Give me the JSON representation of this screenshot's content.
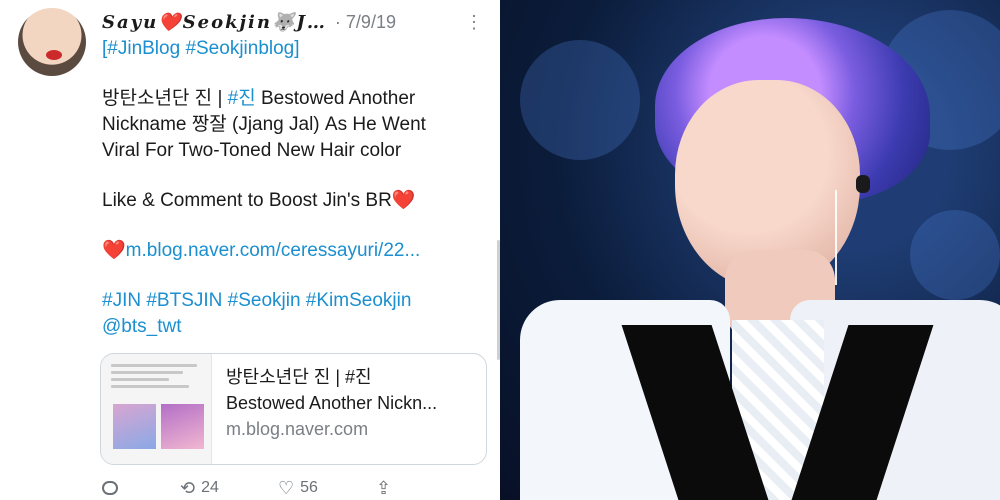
{
  "tweet": {
    "author_display_name": "𝑺𝒂𝒚𝒖❤️𝑺𝒆𝒐𝒌𝒋𝒊𝒏🐺𝑱…",
    "date": "· 7/9/19",
    "lines": {
      "tags_line": "[#JinBlog #Seokjinblog]",
      "headline_prefix": "방탄소년단 진 | ",
      "headline_hashtag": "#진",
      "headline_rest_1": " Bestowed Another",
      "headline_line_2": "Nickname 짱잘 (Jjang Jal) As He Went",
      "headline_line_3": "Viral For Two-Toned New Hair color",
      "cta": "Like & Comment to Boost Jin's BR",
      "link": "m.blog.naver.com/ceressayuri/22...",
      "hashtags": "#JIN #BTSJIN #Seokjin #KimSeokjin",
      "mention": "@bts_twt"
    },
    "emoji": {
      "heart": "❤️"
    },
    "card": {
      "title_line_1": "방탄소년단 진 | #진",
      "title_line_2": "Bestowed Another Nickn...",
      "domain": "m.blog.naver.com"
    },
    "actions": {
      "retweets": "24",
      "likes": "56"
    },
    "icons": {
      "more": "more-icon",
      "reply": "reply-icon",
      "retweet": "retweet-icon",
      "like": "like-icon",
      "share": "share-icon"
    }
  },
  "colors": {
    "link_blue": "#1b8fcf",
    "heart_red": "#e0202a",
    "muted_gray": "#7a7f85"
  }
}
